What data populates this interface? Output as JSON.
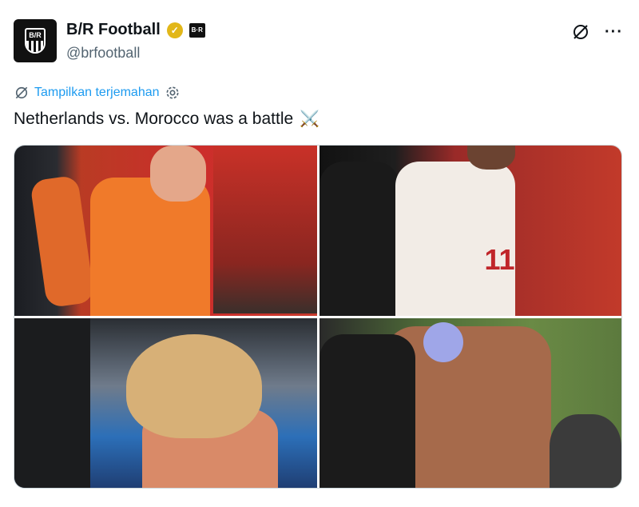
{
  "post": {
    "display_name": "B/R Football",
    "handle": "@brfootball",
    "avatar_text": "B/R",
    "affiliate_badge": "B·R",
    "verified_color": "#e2b719",
    "translate_label": "Tampilkan terjemahan",
    "text": "Netherlands vs. Morocco was a battle",
    "emoji": "⚔️",
    "more_label": "···"
  },
  "colors": {
    "link": "#1d9bf0",
    "text": "#0f1419",
    "secondary": "#536471"
  },
  "photos": [
    {
      "name": "photo-netherlands-player"
    },
    {
      "name": "photo-referee-morocco-player",
      "number": "11"
    },
    {
      "name": "photo-blond-player-treated"
    },
    {
      "name": "photo-shirtless-player-treated"
    }
  ]
}
